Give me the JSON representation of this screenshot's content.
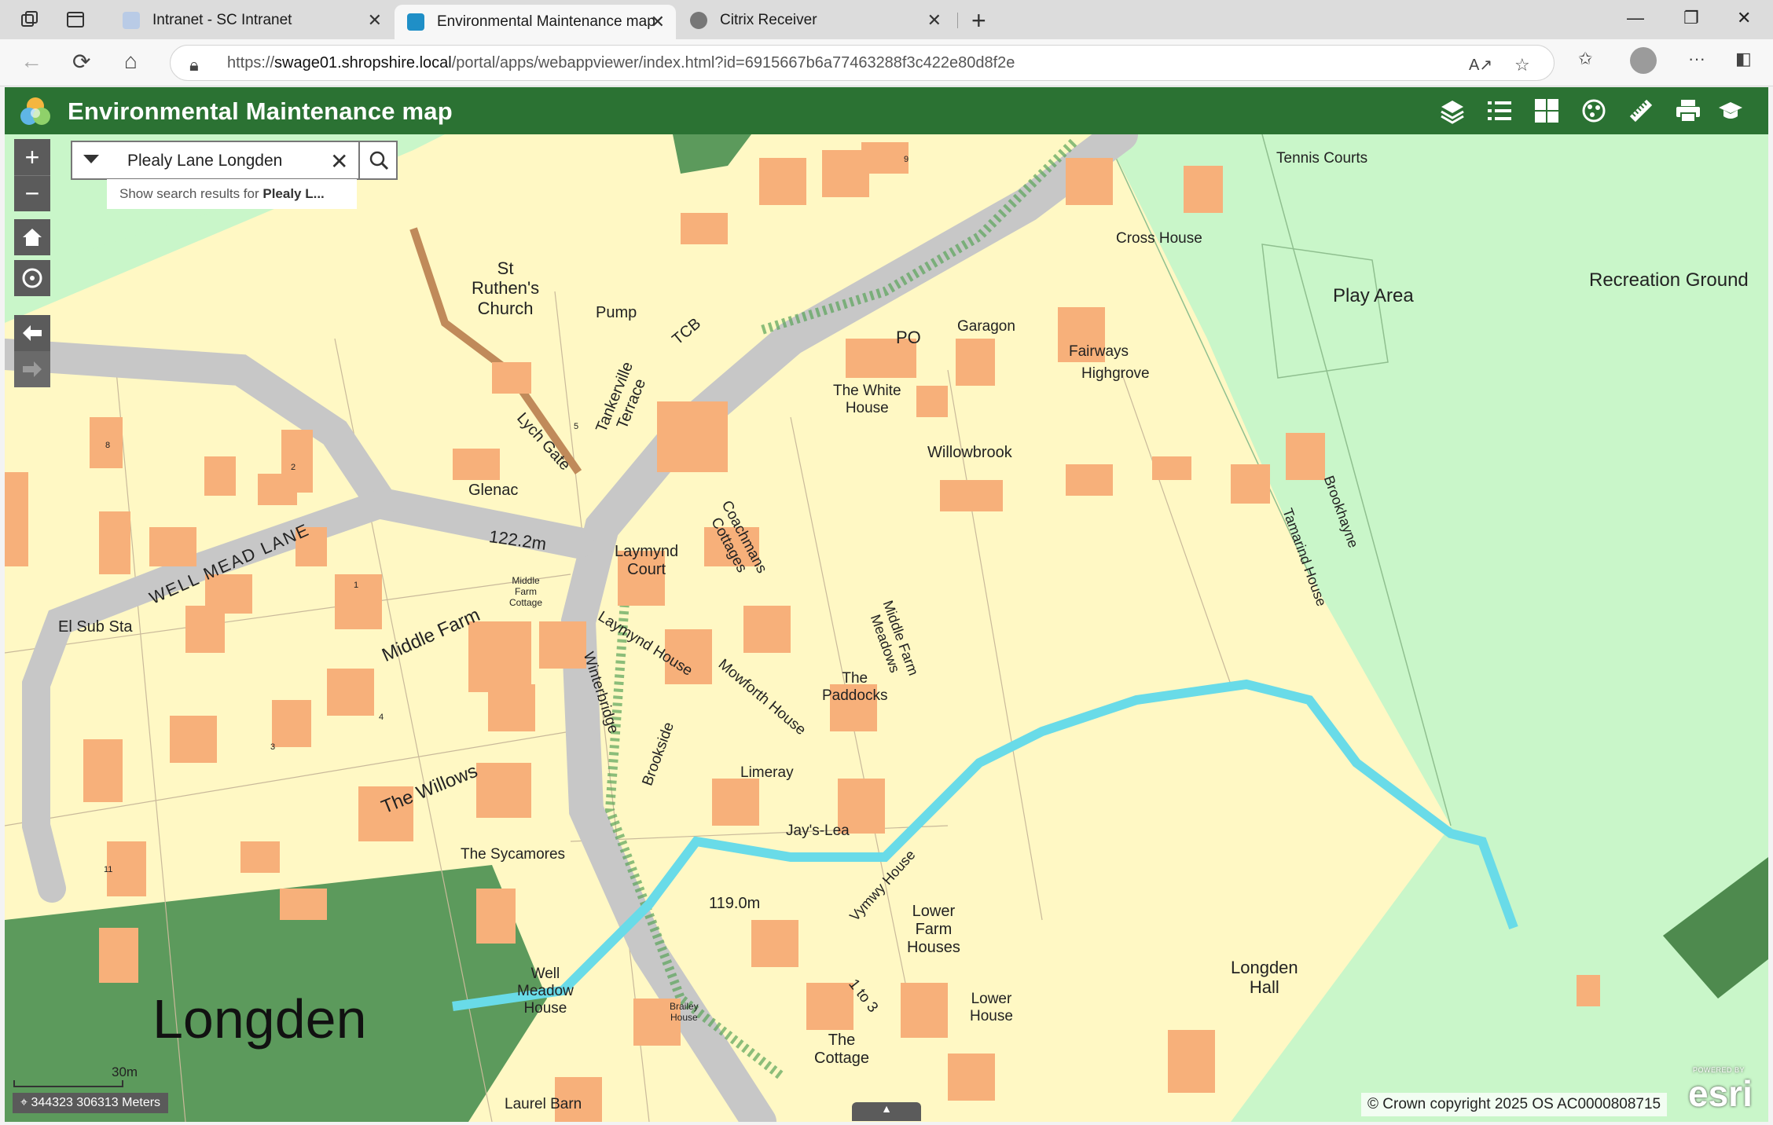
{
  "browser": {
    "tabs": [
      {
        "title": "Intranet - SC Intranet",
        "icon": "intranet-favicon"
      },
      {
        "title": "Environmental Maintenance map",
        "icon": "arcgis-favicon",
        "active": true
      },
      {
        "title": "Citrix Receiver",
        "icon": "citrix-favicon"
      }
    ],
    "url_prefix": "https://",
    "url_host": "swage01.shropshire.local",
    "url_path": "/portal/apps/webappviewer/index.html?id=6915667b6a77463288f3c422e80d8f2e"
  },
  "app": {
    "title": "Environmental Maintenance map",
    "header_color": "#2b7233",
    "tools": [
      "layers-icon",
      "legend-icon",
      "basemap-gallery-icon",
      "analysis-icon",
      "measure-icon",
      "print-icon",
      "education-icon"
    ]
  },
  "search": {
    "value": "Plealy Lane Longden",
    "suggestion_prefix": "Show search results for ",
    "suggestion_bold": "Plealy L..."
  },
  "map": {
    "labels": {
      "st_ruthens": "St\nRuthen's\nChurch",
      "pump": "Pump",
      "tcb": "TCB",
      "tankerville": "Tankerville\nTerrace",
      "lych_gate": "Lych Gate",
      "glenac": "Glenac",
      "elev1": "122.2m",
      "elev2": "119.0m",
      "well_mead": "WELL  MEAD  LANE",
      "el_sub": "El Sub Sta",
      "middle_farm": "Middle Farm",
      "mf_cottage": "Middle\nFarm\nCottage",
      "laymynd_court": "Laymynd\nCourt",
      "coachmans": "Coachmans\nCottages",
      "laymynd_house": "Laymynd House",
      "winterbridge": "Winterbridge",
      "brookside": "Brookside",
      "mowforth": "Mowforth House",
      "the_paddocks": "The\nPaddocks",
      "middle_farm_meadows": "Middle Farm\nMeadows",
      "limeray": "Limeray",
      "jays_lea": "Jay's-Lea",
      "the_willows": "The Willows",
      "the_sycamores": "The Sycamores",
      "vymwy": "Vymwy House",
      "lower_farm": "Lower\nFarm\nHouses",
      "lower_house": "Lower\nHouse",
      "one_to_three": "1 to 3",
      "the_cottage": "The\nCottage",
      "well_meadow": "Well\nMeadow\nHouse",
      "brailey": "Brailey\nHouse",
      "laurel_barn": "Laurel Barn",
      "longden": "Longden",
      "longden_hall": "Longden\nHall",
      "po": "PO",
      "garagon": "Garagon",
      "the_white_house": "The White\nHouse",
      "fairways": "Fairways",
      "highgrove": "Highgrove",
      "willowbrook": "Willowbrook",
      "cross_house": "Cross House",
      "tennis": "Tennis Courts",
      "play_area": "Play Area",
      "recreation": "Recreation Ground",
      "tamarind": "Tamarind House",
      "brookhayne": "Brookhayne",
      "n2": "2",
      "n5": "5",
      "n4": "4",
      "n3": "3",
      "n11": "11",
      "n1": "1",
      "n9": "9",
      "n8": "8"
    },
    "scale_label": "30m",
    "coordinates": "344323 306313 Meters",
    "copyright": "© Crown copyright 2025 OS AC0000808715",
    "esri_powered": "POWERED BY",
    "esri_logo": "esri"
  }
}
